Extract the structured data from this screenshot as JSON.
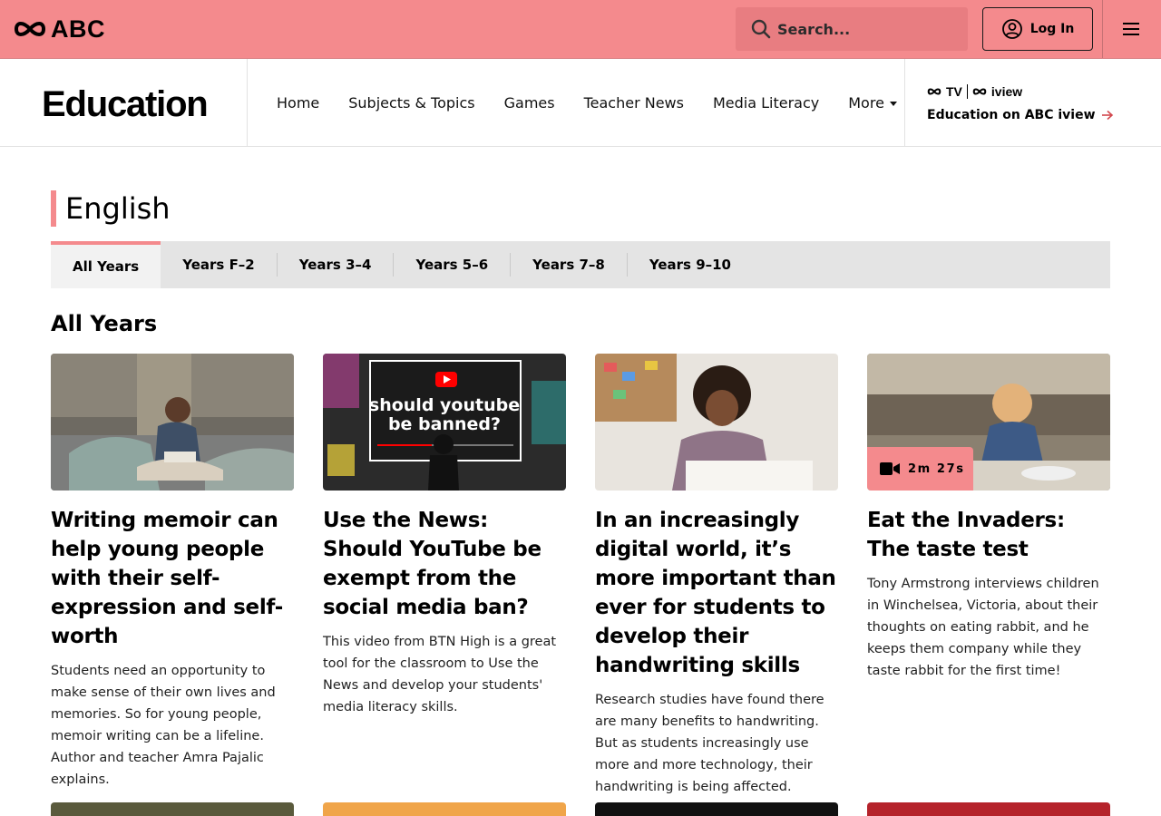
{
  "header": {
    "logo_text": "ABC",
    "search_placeholder": "Search...",
    "login_label": "Log In",
    "brand_color": "#f48a8d"
  },
  "subnav": {
    "brand": "Education",
    "links": [
      "Home",
      "Subjects & Topics",
      "Games",
      "Teacher News",
      "Media Literacy"
    ],
    "more_label": "More",
    "iview": {
      "logo_tv": "TV",
      "logo_iview": "iview",
      "link_label": "Education on ABC iview"
    }
  },
  "page": {
    "title": "English",
    "tabs": [
      {
        "label": "All Years",
        "active": true
      },
      {
        "label": "Years F–2"
      },
      {
        "label": "Years 3–4"
      },
      {
        "label": "Years 5–6"
      },
      {
        "label": "Years 7–8"
      },
      {
        "label": "Years 9–10"
      }
    ],
    "subheading": "All Years"
  },
  "cards": [
    {
      "title": "Writing memoir can help young people with their self-expression and self-worth",
      "description": "Students need an opportunity to make sense of their own lives and memories. So for young people, memoir writing can be a lifeline. Author and teacher Amra Pajalic explains."
    },
    {
      "title": "Use the News: Should YouTube be exempt from the social media ban?",
      "description": "This video from BTN High is a great tool for the classroom to Use the News and develop your students' media literacy skills.",
      "thumb_text": "should youtube be banned?"
    },
    {
      "title": "In an increasingly digital world, it’s more important than ever for students to develop their handwriting skills",
      "description": "Research studies have found there are many benefits to handwriting. But as students increasingly use more and more technology, their handwriting is being affected."
    },
    {
      "title": "Eat the Invaders: The taste test",
      "description": "Tony Armstrong interviews children in Winchelsea, Victoria, about their thoughts on eating rabbit, and he keeps them company while they taste rabbit for the first time!",
      "duration": "2m 27s"
    }
  ]
}
